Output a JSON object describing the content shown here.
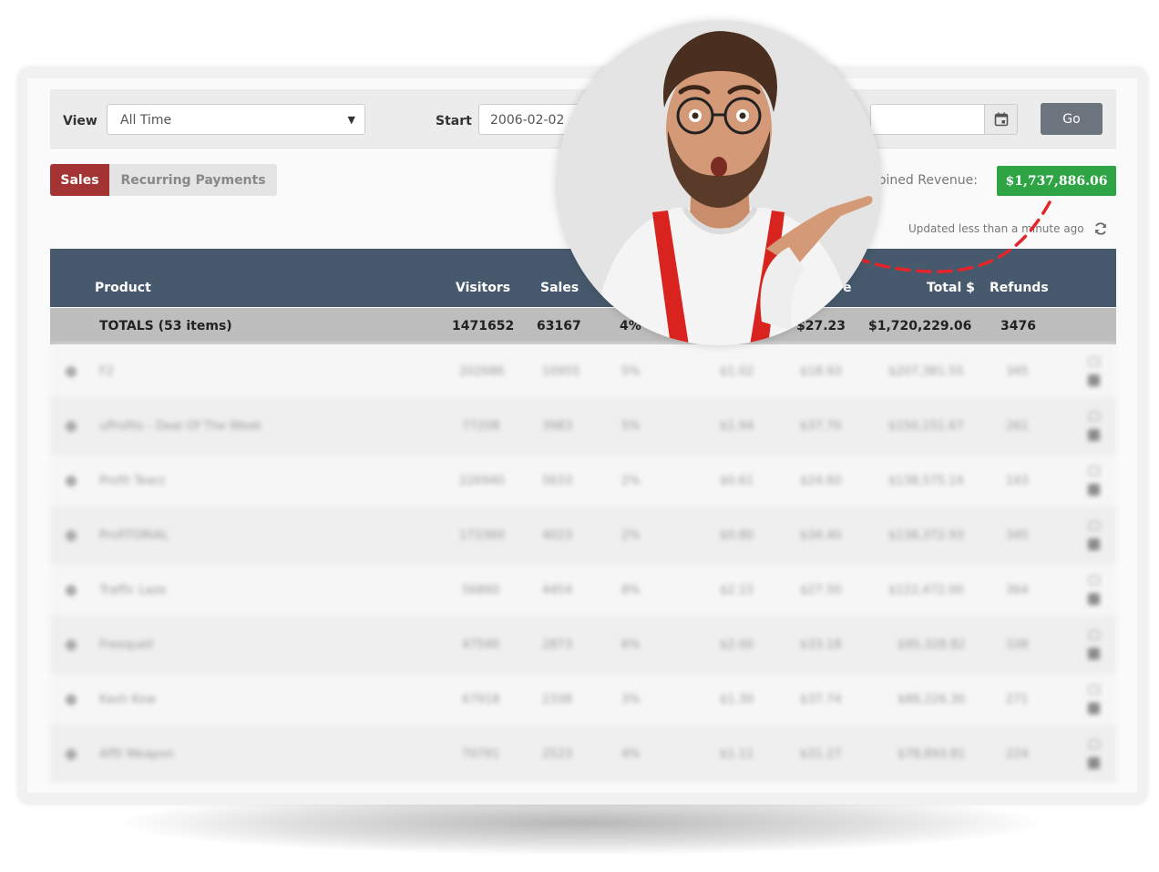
{
  "filters": {
    "view_label": "View",
    "view_value": "All Time",
    "start_label": "Start",
    "start_value": "2006-02-02",
    "end_value": "",
    "go_label": "Go"
  },
  "tabs": [
    {
      "label": "Sales",
      "active": true
    },
    {
      "label": "Recurring Payments",
      "active": false
    }
  ],
  "revenue": {
    "label": "mbined Revenue:",
    "value": "$1,737,886.06"
  },
  "status": {
    "updated": "Updated less than a minute ago",
    "refresh_icon": "refresh-icon"
  },
  "table": {
    "headers": {
      "product": "Product",
      "visitors": "Visitors",
      "sales": "Sales",
      "per_sale_partial": "e",
      "total": "Total $",
      "refunds": "Refunds"
    },
    "totals": {
      "label": "TOTALS (53 items)",
      "visitors": "1471652",
      "sales": "63167",
      "conversion": "4%",
      "per_sale": "$27.23",
      "total": "$1,720,229.06",
      "refunds": "3476"
    },
    "rows": [
      {
        "product": "F2",
        "visitors": "202686",
        "sales": "10955",
        "conversion": "5%",
        "epc": "$1.02",
        "per_sale": "$18.93",
        "total": "$207,381.55",
        "refunds": "345"
      },
      {
        "product": "uProfits - Deal Of The Week",
        "visitors": "77208",
        "sales": "3983",
        "conversion": "5%",
        "epc": "$1.94",
        "per_sale": "$37.70",
        "total": "$150,151.67",
        "refunds": "261"
      },
      {
        "product": "Profit Tearz",
        "visitors": "226940",
        "sales": "5633",
        "conversion": "2%",
        "epc": "$0.61",
        "per_sale": "$24.60",
        "total": "$138,575.14",
        "refunds": "143"
      },
      {
        "product": "ProfiTORIAL",
        "visitors": "173360",
        "sales": "4023",
        "conversion": "2%",
        "epc": "$0.80",
        "per_sale": "$34.40",
        "total": "$138,372.93",
        "refunds": "345"
      },
      {
        "product": "Traffic Laze",
        "visitors": "56860",
        "sales": "4454",
        "conversion": "8%",
        "epc": "$2.15",
        "per_sale": "$27.50",
        "total": "$122,472.00",
        "refunds": "364"
      },
      {
        "product": "Freequell",
        "visitors": "47590",
        "sales": "2873",
        "conversion": "6%",
        "epc": "$2.00",
        "per_sale": "$33.18",
        "total": "$95,328.82",
        "refunds": "108"
      },
      {
        "product": "Kash Kow",
        "visitors": "67918",
        "sales": "2338",
        "conversion": "3%",
        "epc": "$1.30",
        "per_sale": "$37.74",
        "total": "$88,226.30",
        "refunds": "271"
      },
      {
        "product": "Affil Weapon",
        "visitors": "70791",
        "sales": "2523",
        "conversion": "4%",
        "epc": "$1.11",
        "per_sale": "$31.27",
        "total": "$78,893.81",
        "refunds": "224"
      }
    ],
    "row_icons": [
      "expand-bullet-icon",
      "list-icon",
      "trash-icon"
    ]
  },
  "colors": {
    "sales_tab": "#a43434",
    "revenue_badge": "#2ea444",
    "table_header": "#475a6d",
    "totals_row": "#bdbdbd",
    "go_button": "#6c757d",
    "dashed_arrow": "#e5252a"
  },
  "portrait": {
    "subject": "surprised-man-pointing"
  }
}
